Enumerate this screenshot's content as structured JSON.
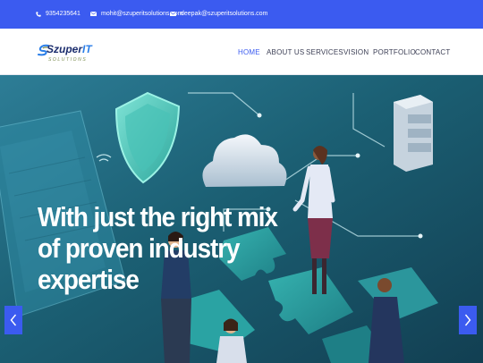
{
  "topbar": {
    "phone": "9354235641",
    "email_1": "mohit@szuperitsolutions.com",
    "email_2": "deepak@szuperitsolutions.com"
  },
  "logo": {
    "brand_prefix": "Szuper",
    "brand_suffix": "IT",
    "tagline": "SOLUTIONS"
  },
  "nav": {
    "items": [
      {
        "label": "HOME",
        "active": true
      },
      {
        "label": "ABOUT US",
        "active": false
      },
      {
        "label": "SERVICES",
        "active": false
      },
      {
        "label": "VISION",
        "active": false
      },
      {
        "label": "PORTFOLIO",
        "active": false
      },
      {
        "label": "CONTACT",
        "active": false
      }
    ]
  },
  "hero": {
    "headline_line_1": "With just the right mix",
    "headline_line_2": "of proven industry",
    "headline_line_3": "expertise"
  },
  "icons": {
    "phone": "phone-icon",
    "email": "envelope-icon",
    "prev": "chevron-left-icon",
    "next": "chevron-right-icon"
  },
  "colors": {
    "accent": "#3b5bf0",
    "nav_text": "#3c3f55",
    "hero_teal": "#1f6a7c",
    "headline": "#ffffff"
  }
}
